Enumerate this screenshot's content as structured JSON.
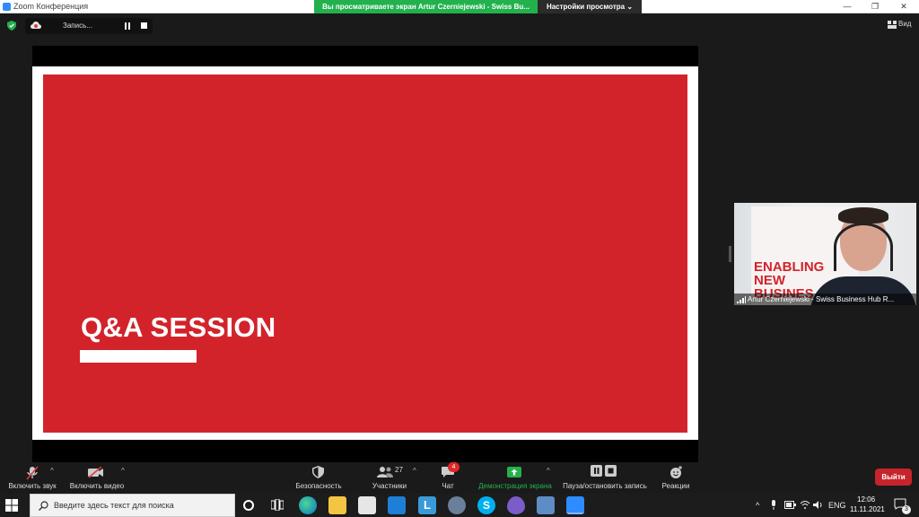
{
  "window": {
    "title": "Zoom Конференция",
    "share_banner": "Вы просматриваете экран Artur Czerniejewski - Swiss Bu...",
    "view_settings": "Настройки просмотра",
    "view_settings_icon": "chevron-down-icon"
  },
  "top_bar": {
    "recording_label": "Запись...",
    "view_label": "Вид"
  },
  "slide": {
    "title": "Q&A SESSION",
    "accent_color": "#d2232b"
  },
  "speaker": {
    "name": "Artur Czerniejewski - Swiss Business Hub R...",
    "banner_text": "ENABLING\nNEW\nBUSINES"
  },
  "toolbar": {
    "audio_label": "Включить звук",
    "video_label": "Включить видео",
    "security_label": "Безопасность",
    "participants_label": "Участники",
    "participants_count": "27",
    "chat_label": "Чат",
    "chat_badge": "4",
    "share_label": "Демонстрация экрана",
    "record_label": "Пауза/остановить запись",
    "reactions_label": "Реакции",
    "leave_label": "Выйти"
  },
  "taskbar": {
    "search_placeholder": "Введите здесь текст для поиска",
    "language": "ENG",
    "time": "12:06",
    "date": "11.11.2021",
    "notification_count": "3"
  }
}
